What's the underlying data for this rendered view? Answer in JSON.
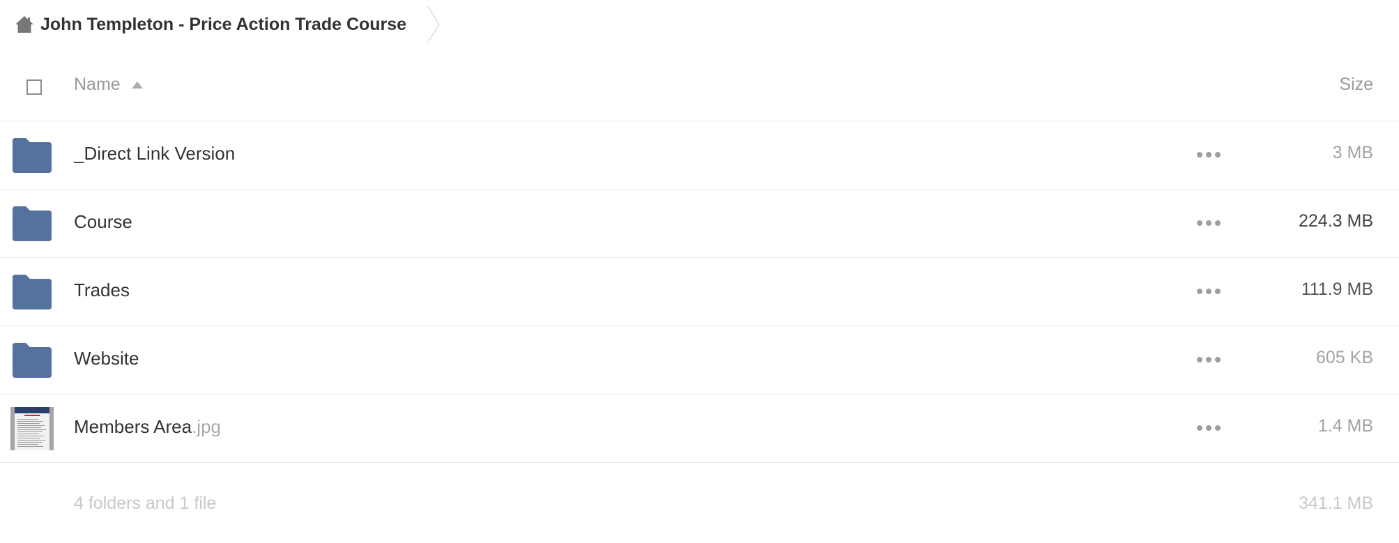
{
  "breadcrumb": {
    "home_icon": "home-icon",
    "title": "John Templeton - Price Action Trade Course"
  },
  "header": {
    "name_label": "Name",
    "size_label": "Size",
    "sort_icon": "sort-ascending-icon"
  },
  "rows": [
    {
      "type": "folder",
      "icon": "folder-icon",
      "name": "_Direct Link Version",
      "ext": "",
      "size": "3 MB",
      "size_color": "#a3a3a3"
    },
    {
      "type": "folder",
      "icon": "folder-icon",
      "name": "Course",
      "ext": "",
      "size": "224.3 MB",
      "size_color": "#444444"
    },
    {
      "type": "folder",
      "icon": "folder-icon",
      "name": "Trades",
      "ext": "",
      "size": "111.9 MB",
      "size_color": "#555555"
    },
    {
      "type": "folder",
      "icon": "folder-icon",
      "name": "Website",
      "ext": "",
      "size": "605 KB",
      "size_color": "#a3a3a3"
    },
    {
      "type": "image",
      "icon": "image-thumbnail",
      "name": "Members Area",
      "ext": ".jpg",
      "size": "1.4 MB",
      "size_color": "#a3a3a3"
    }
  ],
  "summary": {
    "label": "4 folders and 1 file",
    "size": "341.1 MB"
  },
  "colors": {
    "folder": "#55729f",
    "muted_text": "#999999",
    "divider": "#ebebeb"
  }
}
